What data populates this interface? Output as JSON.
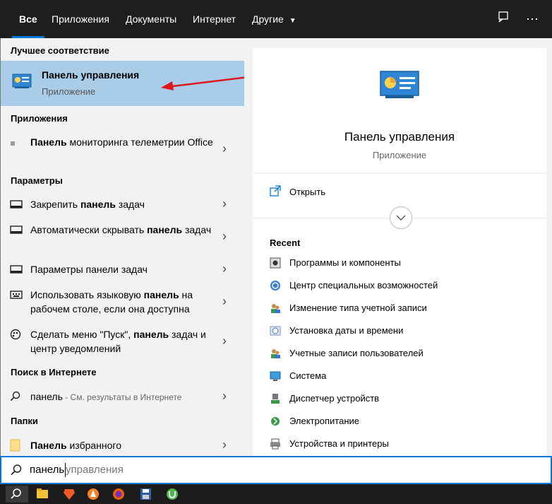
{
  "tabs": [
    "Все",
    "Приложения",
    "Документы",
    "Интернет",
    "Другие"
  ],
  "top_icons": [
    "feedback-icon",
    "more-icon"
  ],
  "best_match": {
    "header": "Лучшее соответствие",
    "title": "Панель управления",
    "subtitle": "Приложение"
  },
  "apps": {
    "header": "Приложения",
    "items": [
      {
        "bold": "Панель",
        "rest": " мониторинга телеметрии Office"
      }
    ]
  },
  "settings": {
    "header": "Параметры",
    "items": [
      {
        "pre": "Закрепить ",
        "bold": "панель",
        "post": " задач"
      },
      {
        "pre": "Автоматически скрывать ",
        "bold": "панель",
        "post": " задач"
      },
      {
        "pre": "Параметры панели задач",
        "bold": "",
        "post": ""
      },
      {
        "pre": "Использовать языковую ",
        "bold": "панель",
        "post": " на рабочем столе, если она доступна"
      },
      {
        "pre": "Сделать меню \"Пуск\", ",
        "bold": "панель",
        "post": " задач и центр уведомлений"
      }
    ]
  },
  "web": {
    "header": "Поиск в Интернете",
    "query": "панель",
    "suffix": " - См. результаты в Интернете"
  },
  "folders": {
    "header": "Папки",
    "items": [
      {
        "bold": "Панель",
        "rest": " избранного"
      }
    ]
  },
  "preview": {
    "title": "Панель управления",
    "subtitle": "Приложение",
    "open_label": "Открыть",
    "recent_header": "Recent",
    "recent": [
      "Программы и компоненты",
      "Центр специальных возможностей",
      "Изменение типа учетной записи",
      "Установка даты и времени",
      "Учетные записи пользователей",
      "Система",
      "Диспетчер устройств",
      "Электропитание",
      "Устройства и принтеры"
    ]
  },
  "search": {
    "typed": "панель",
    "suggestion": " управления"
  },
  "taskbar": [
    "search-icon",
    "file-explorer-icon",
    "brave-icon",
    "avast-icon",
    "firefox-icon",
    "floppy-icon",
    "utorrent-icon"
  ],
  "colors": {
    "accent": "#0078d7",
    "selected": "#a9cde9",
    "arrow": "#e0161c"
  }
}
